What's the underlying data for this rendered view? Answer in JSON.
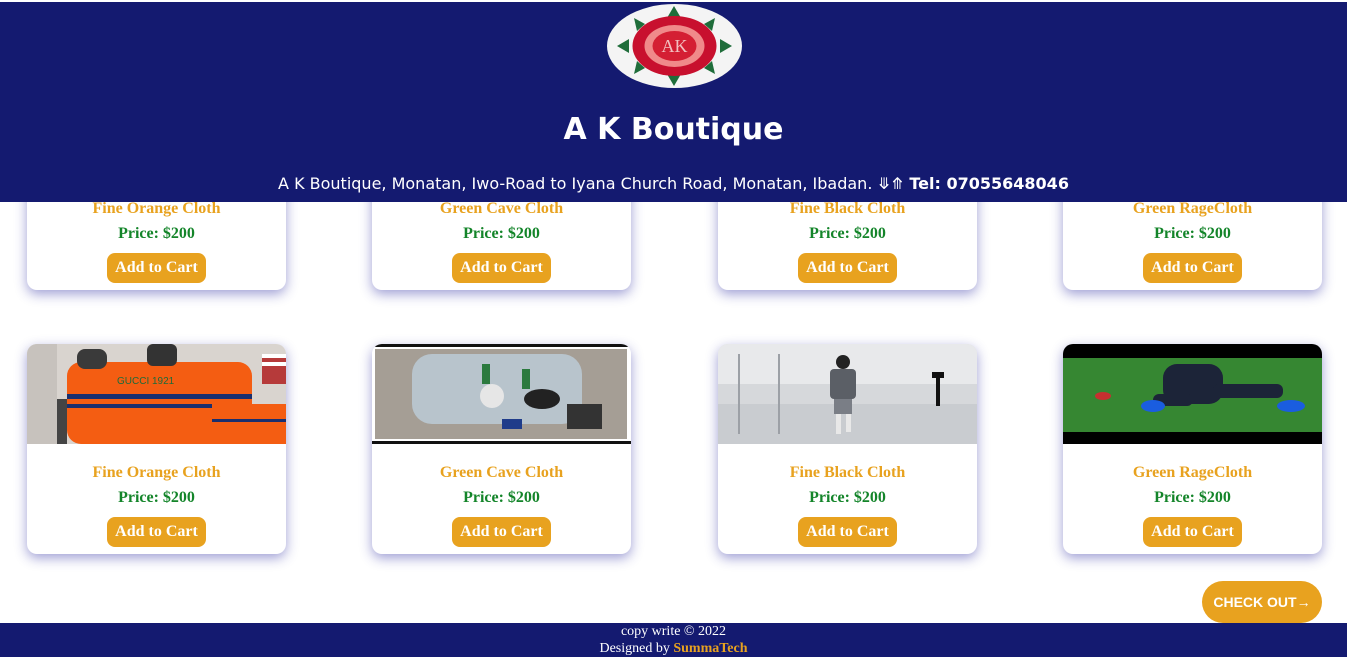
{
  "header": {
    "logo_text": "AK",
    "title": "A K Boutique",
    "address": "A K Boutique, Monatan, Iwo-Road to Iyana Church Road, Monatan, Ibadan. ⤋⤊",
    "tel": "Tel: 07055648046"
  },
  "products_row1": [
    {
      "name": "Fine Orange Cloth",
      "price": "Price: $200",
      "button": "Add to Cart"
    },
    {
      "name": "Green Cave Cloth",
      "price": "Price: $200",
      "button": "Add to Cart"
    },
    {
      "name": "Fine Black Cloth",
      "price": "Price: $200",
      "button": "Add to Cart"
    },
    {
      "name": "Green RageCloth",
      "price": "Price: $200",
      "button": "Add to Cart"
    }
  ],
  "products_row2": [
    {
      "name": "Fine Orange Cloth",
      "price": "Price: $200",
      "button": "Add to Cart"
    },
    {
      "name": "Green Cave Cloth",
      "price": "Price: $200",
      "button": "Add to Cart"
    },
    {
      "name": "Fine Black Cloth",
      "price": "Price: $200",
      "button": "Add to Cart"
    },
    {
      "name": "Green RageCloth",
      "price": "Price: $200",
      "button": "Add to Cart"
    }
  ],
  "checkout_label": "CHECK OUT→",
  "footer": {
    "copyright": "copy write © 2022",
    "designed_by": "Designed by",
    "brand": "SummaTech"
  },
  "colors": {
    "header_bg": "#141a70",
    "accent": "#e8a21f",
    "price": "#14852a"
  }
}
